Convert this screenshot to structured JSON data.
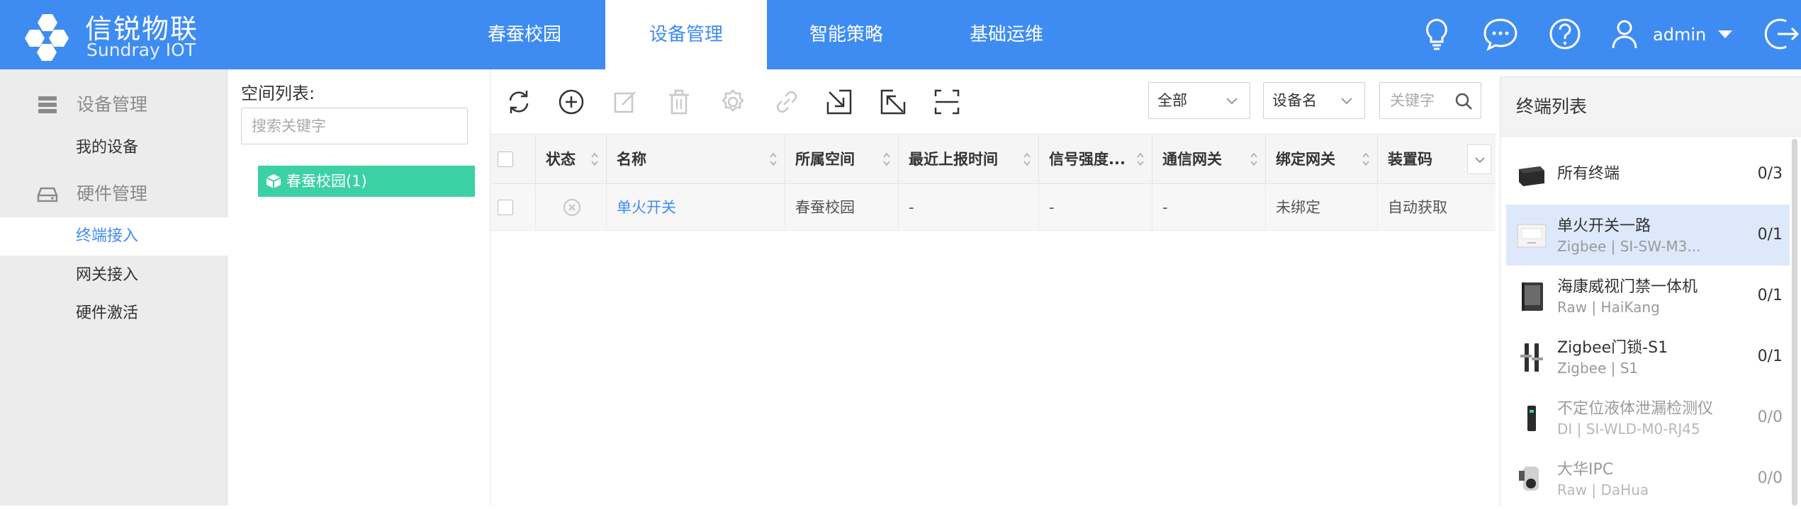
{
  "brand": {
    "name": "信锐物联",
    "subtitle": "Sundray IOT",
    "primary_color": "#3e8cf2",
    "accent_green": "#3cd0a5"
  },
  "nav": {
    "items": [
      {
        "label": "春蚕校园",
        "active": false
      },
      {
        "label": "设备管理",
        "active": true
      },
      {
        "label": "智能策略",
        "active": false
      },
      {
        "label": "基础运维",
        "active": false
      }
    ]
  },
  "header_right": {
    "icons": [
      "lightbulb-icon",
      "chat-icon",
      "help-icon",
      "user-icon",
      "chevron-down-icon",
      "logout-icon"
    ],
    "username": "admin"
  },
  "sidebar": {
    "groups": [
      {
        "label": "设备管理",
        "icon": "device-stack-icon",
        "items": [
          {
            "label": "我的设备",
            "active": false
          }
        ]
      },
      {
        "label": "硬件管理",
        "icon": "hardware-icon",
        "items": [
          {
            "label": "终端接入",
            "active": true
          },
          {
            "label": "网关接入",
            "active": false
          },
          {
            "label": "硬件激活",
            "active": false
          }
        ]
      }
    ]
  },
  "space_panel": {
    "title": "空间列表:",
    "search_placeholder": "搜索关键字",
    "tree": [
      {
        "label": "春蚕校园(1)",
        "selected": true,
        "icon": "cube-icon"
      }
    ]
  },
  "toolbar": {
    "buttons": [
      {
        "name": "refresh-icon",
        "enabled": true
      },
      {
        "name": "add-icon",
        "enabled": true
      },
      {
        "name": "edit-icon",
        "enabled": false
      },
      {
        "name": "delete-icon",
        "enabled": false
      },
      {
        "name": "settings-icon",
        "enabled": false
      },
      {
        "name": "link-icon",
        "enabled": false
      },
      {
        "name": "import-icon",
        "enabled": true
      },
      {
        "name": "export-icon",
        "enabled": true
      },
      {
        "name": "scan-icon",
        "enabled": true
      }
    ],
    "filter_select": "全部",
    "field_select": "设备名",
    "keyword_placeholder": "关键字"
  },
  "table": {
    "columns": [
      "状态",
      "名称",
      "所属空间",
      "最近上报时间",
      "信号强度...",
      "通信网关",
      "绑定网关",
      "装置码"
    ],
    "rows": [
      {
        "status": "offline-icon",
        "name": "单火开关",
        "space": "春蚕校园",
        "last_report": "-",
        "signal": "-",
        "comm_gateway": "-",
        "bind_gateway": "未绑定",
        "device_code": "自动获取"
      }
    ]
  },
  "terminal_list": {
    "title": "终端列表",
    "items": [
      {
        "name": "所有终端",
        "sub": "",
        "count": "0/3",
        "active": false,
        "dim": false,
        "thumb": "all-terminals-icon"
      },
      {
        "name": "单火开关一路",
        "sub": "Zigbee | SI-SW-M3...",
        "count": "0/1",
        "active": true,
        "dim": false,
        "thumb": "wall-switch-icon"
      },
      {
        "name": "海康威视门禁一体机",
        "sub": "Raw | HaiKang",
        "count": "0/1",
        "active": false,
        "dim": false,
        "thumb": "access-control-icon"
      },
      {
        "name": "Zigbee门锁-S1",
        "sub": "Zigbee | S1",
        "count": "0/1",
        "active": false,
        "dim": false,
        "thumb": "door-lock-icon"
      },
      {
        "name": "不定位液体泄漏检测仪",
        "sub": "DI | SI-WLD-M0-RJ45",
        "count": "0/0",
        "active": false,
        "dim": true,
        "thumb": "leak-detector-icon"
      },
      {
        "name": "大华IPC",
        "sub": "Raw | DaHua",
        "count": "0/0",
        "active": false,
        "dim": true,
        "thumb": "ip-camera-icon"
      }
    ]
  }
}
